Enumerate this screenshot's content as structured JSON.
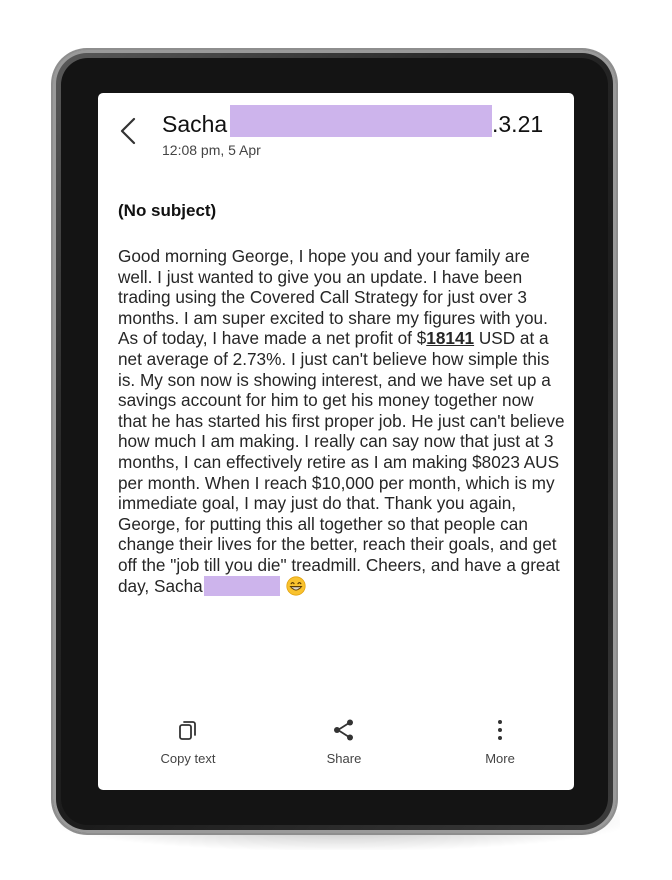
{
  "header": {
    "sender_name": "Sacha",
    "sender_tail": ".3.21",
    "timestamp": "12:08 pm, 5 Apr"
  },
  "email": {
    "subject": "(No subject)",
    "body_part1": "Good morning George, I hope you and your family are well. I just wanted to give you an update. I have been trading using the Covered Call Strategy for just over 3 months. I am super excited to share my figures with you. As of today, I have made a net profit of $",
    "profit_amount": "18141",
    "body_part2": " USD at a net average of 2.73%. I just can't believe how simple this is. My son now is showing interest, and we have set up a savings account for him to get his money together now that he has started his first proper job. He just can't believe how much I am making. I really can say now that just at 3 months, I can effectively retire as I am making $8023 AUS per month. When I reach $10,000 per month, which is my immediate goal, I may just do that. Thank you again, George, for putting this all together so that people can change their lives for the better, reach their goals, and get off the \"job till you die\" treadmill. Cheers, and have a great day,  Sacha"
  },
  "actions": {
    "copy_label": "Copy text",
    "share_label": "Share",
    "more_label": "More"
  },
  "icons": {
    "back": "chevron-left-icon",
    "copy": "copy-icon",
    "share": "share-icon",
    "more": "more-vertical-icon",
    "emoji": "grinning-face-emoji"
  },
  "colors": {
    "redaction": "#cdb4ec",
    "bezel": "#1c1c1c"
  }
}
